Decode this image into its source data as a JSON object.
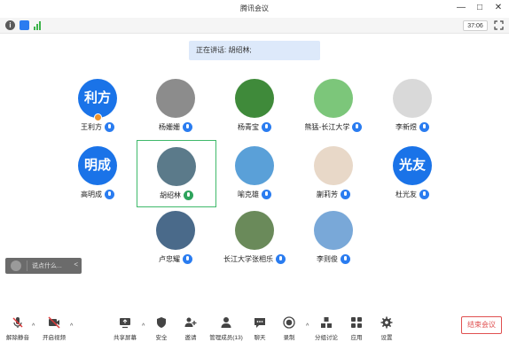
{
  "window": {
    "title": "腾讯会议",
    "minimize": "—",
    "maximize": "□",
    "close": "✕"
  },
  "status": {
    "timer": "37:06"
  },
  "banner": {
    "speaking_text": "正在讲话: 胡绍林;"
  },
  "participants": [
    {
      "name": "王利方",
      "avatar_text": "利方",
      "avatar_color": "#1a73e8",
      "host": true
    },
    {
      "name": "杨姗姗",
      "avatar_text": "",
      "avatar_color": "#8c8c8c"
    },
    {
      "name": "杨青宝",
      "avatar_text": "",
      "avatar_color": "#3f8a3a"
    },
    {
      "name": "熊猛-长江大学",
      "avatar_text": "",
      "avatar_color": "#7cc67a"
    },
    {
      "name": "李新煜",
      "avatar_text": "",
      "avatar_color": "#d9d9d9"
    },
    {
      "name": "高明成",
      "avatar_text": "明成",
      "avatar_color": "#1a73e8"
    },
    {
      "name": "胡绍林",
      "avatar_text": "",
      "avatar_color": "#5b7a8a",
      "speaking": true
    },
    {
      "name": "喻克雄",
      "avatar_text": "",
      "avatar_color": "#5aa0d8"
    },
    {
      "name": "蒯莉芳",
      "avatar_text": "",
      "avatar_color": "#e8d8c8"
    },
    {
      "name": "杜光友",
      "avatar_text": "光友",
      "avatar_color": "#1a73e8"
    },
    {
      "name": "卢忠耀",
      "avatar_text": "",
      "avatar_color": "#4a6a8a"
    },
    {
      "name": "长江大学张相乐",
      "avatar_text": "",
      "avatar_color": "#6a8a5a"
    },
    {
      "name": "李则俊",
      "avatar_text": "",
      "avatar_color": "#79a8d8"
    }
  ],
  "chat": {
    "placeholder": "说点什么...",
    "collapse": "<"
  },
  "toolbar": {
    "unmute": "解除静音",
    "start_video": "开启视频",
    "share_screen": "共享屏幕",
    "security": "安全",
    "invite": "邀请",
    "members": "管理成员(13)",
    "chat": "聊天",
    "record": "录制",
    "breakout": "分组讨论",
    "apps": "应用",
    "settings": "设置",
    "end_meeting": "结束会议"
  }
}
